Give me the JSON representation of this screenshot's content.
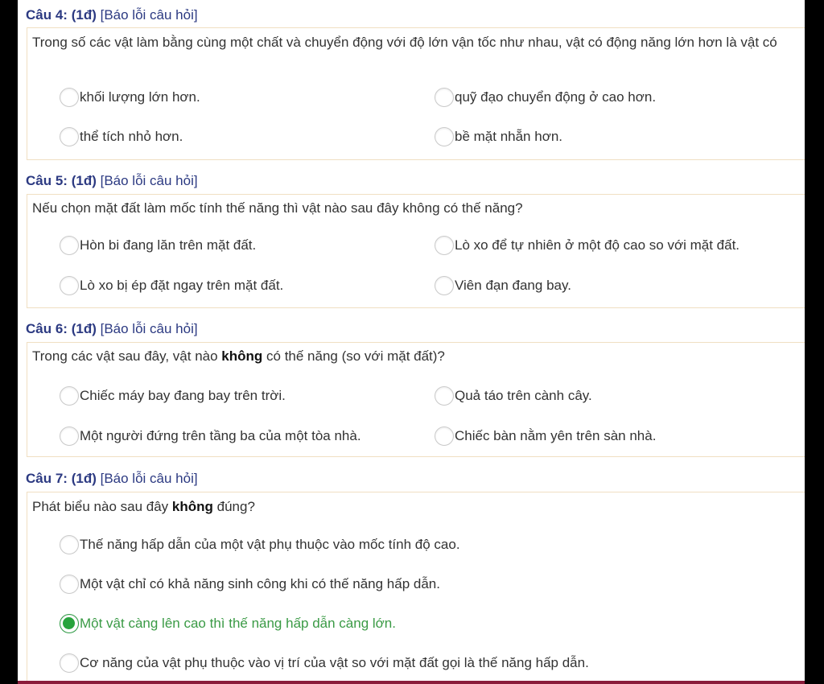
{
  "questions": [
    {
      "number": "Câu 4:",
      "points": "(1đ)",
      "report": "[Báo lỗi câu hỏi]",
      "text": "Trong số các vật làm bằng cùng một chất và chuyển động với độ lớn vận tốc như nhau, vật có động năng lớn hơn là vật có",
      "options": [
        "khối lượng lớn hơn.",
        "quỹ đạo chuyển động ở cao hơn.",
        "thể tích nhỏ hơn.",
        "bề mặt nhẵn hơn."
      ]
    },
    {
      "number": "Câu 5:",
      "points": "(1đ)",
      "report": "[Báo lỗi câu hỏi]",
      "text": "Nếu chọn mặt đất làm mốc tính thế năng thì vật nào sau đây không có thế năng?",
      "options": [
        "Hòn bi đang lăn trên mặt đất.",
        "Lò xo để tự nhiên ở một độ cao so với mặt đất.",
        "Lò xo bị ép đặt ngay trên mặt đất.",
        "Viên đạn đang bay."
      ]
    },
    {
      "number": "Câu 6:",
      "points": "(1đ)",
      "report": "[Báo lỗi câu hỏi]",
      "text_before": "Trong các vật sau đây, vật nào ",
      "text_bold": "không",
      "text_after": " có thế năng (so với mặt đất)?",
      "options": [
        "Chiếc máy bay đang bay trên trời.",
        "Quả táo trên cành cây.",
        "Một người đứng trên tầng ba của một tòa nhà.",
        "Chiếc bàn nằm yên trên sàn nhà."
      ]
    },
    {
      "number": "Câu 7:",
      "points": "(1đ)",
      "report": "[Báo lỗi câu hỏi]",
      "text_before": "Phát biểu nào sau đây ",
      "text_bold": "không",
      "text_after": " đúng?",
      "options": [
        "Thế năng hấp dẫn của một vật phụ thuộc vào mốc tính độ cao.",
        "Một vật chỉ có khả năng sinh công khi có thế năng hấp dẫn.",
        "Một vật càng lên cao thì thế năng hấp dẫn càng lớn.",
        "Cơ năng của vật phụ thuộc vào vị trí của vật so với mặt đất gọi là thế năng hấp dẫn."
      ],
      "selected_option": "Một vật càng lên cao thì thế năng hấp dẫn càng lớn."
    }
  ],
  "colors": {
    "header_blue": "#2c3a82",
    "selected_green": "#27a33c",
    "box_border": "#f0dfc2",
    "bottom_bar": "#8b1c3b"
  },
  "icons": {
    "radio": "radio-circle-icon",
    "radio_selected": "radio-checked-icon"
  }
}
